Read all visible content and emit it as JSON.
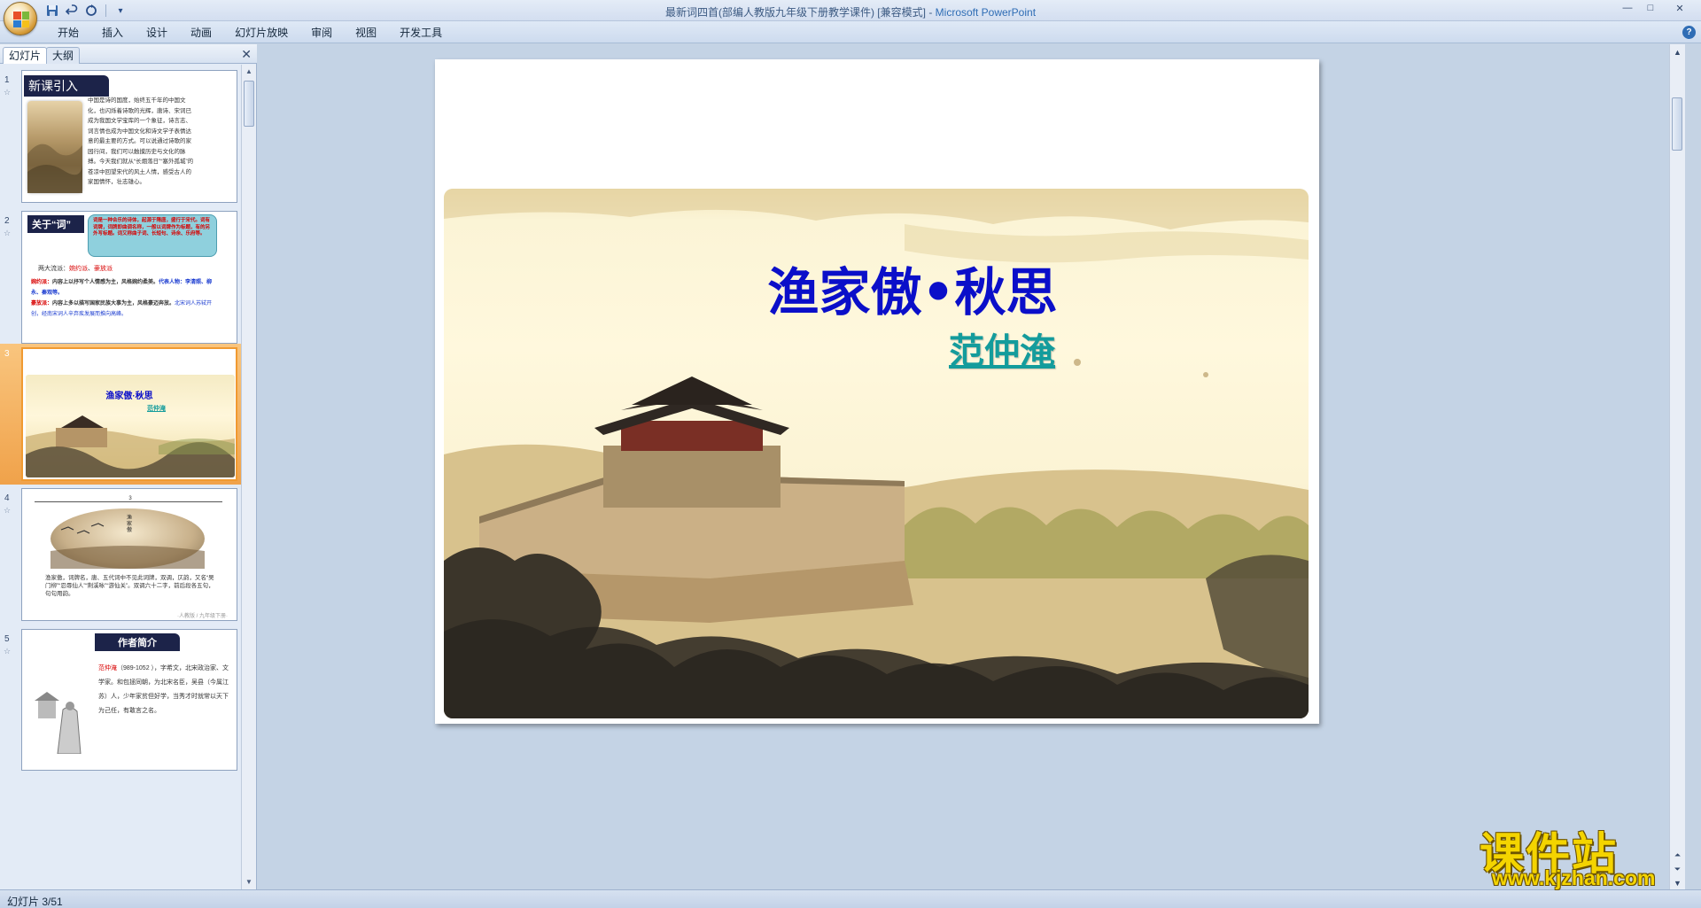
{
  "window": {
    "title": "最新词四首(部编人教版九年级下册教学课件) [兼容模式] - Microsoft PowerPoint",
    "title_doc": "最新词四首(部编人教版九年级下册教学课件) [兼容模式]",
    "title_app": "Microsoft PowerPoint",
    "controls": {
      "minimize": "—",
      "restore": "□",
      "close": "✕"
    }
  },
  "quick_access": {
    "save_icon": "save-icon",
    "undo_icon": "undo-icon",
    "redo_icon": "redo-icon",
    "customize": "▾"
  },
  "ribbon": {
    "tabs": [
      "开始",
      "插入",
      "设计",
      "动画",
      "幻灯片放映",
      "审阅",
      "视图",
      "开发工具"
    ],
    "help": "?"
  },
  "left_panel": {
    "tabs": [
      "幻灯片",
      "大纲"
    ],
    "active_tab": "幻灯片",
    "close": "✕",
    "thumbnails": [
      {
        "number": "1",
        "title": "新课引入",
        "body": "中国是诗的国度，始终五千年的中国文化，也闪烁着诗歌的光辉，唐诗、宋词已成为我国文学宝库的一个象征，诗言志、词言情也成为中国文化和诗文学子表情达意的最主要的方式。可以说通过诗歌的家园行间，我们可以触摸历史与文化的脉搏。今天我们就从“长烟落日”“塞外孤城”的苍凉中回望宋代的风土人情，感受古人的家国情怀，壮志雄心。"
      },
      {
        "number": "2",
        "title": "关于“词”",
        "bubble": "词是一种合乐的诗体，起源于隋唐，盛行于宋代。词有词牌，词牌即曲调名称，一般以词牌作为标题，有的另外写标题。词又称曲子词、长短句、诗余、乐府等。",
        "line1_label": "两大流派：",
        "line1_a": "婉约派",
        "line1_sep": "、",
        "line1_b": "豪放派",
        "line2_label": "婉约派：",
        "line2_text": "内容上以抒写个人情感为主，风格婉约柔美。",
        "line2_reps": "代表人物：李清照、柳永、秦观等。",
        "line3_label": "豪放派：",
        "line3_text": "内容上多以描写国家民族大事为主，风格豪迈奔放。",
        "line3_reps": "北宋词人苏轼开创，经南宋词人辛弃疾发展而推向高峰。"
      },
      {
        "number": "3",
        "title": "渔家傲·秋思",
        "author": "范仲淹"
      },
      {
        "number": "4",
        "ornament": "3",
        "vertical_title": "渔家傲",
        "body": "渔家傲，词牌名，唐、五代词中不见此词牌，双调，仄韵，又名“吴门柳”“忍辱仙人”“荆溪咏”“游仙关”。双调六十二字，前后段各五句，句句用韵。",
        "footer": "·人教版 / 九年级下册·"
      },
      {
        "number": "5",
        "title": "作者简介",
        "name": "范仲淹",
        "years": "（989-1052 ），",
        "body": "字希文，北宋政治家、文学家。和包拯同朝，为北宋名臣，吴县（今属江苏）人，少年家贫但好学，当秀才时就常以天下为己任，有敢言之名。"
      }
    ]
  },
  "slide": {
    "title": "渔家傲•秋思",
    "author": "范仲淹"
  },
  "status": {
    "text": "幻灯片 3/51"
  },
  "watermark": {
    "name": "课件站",
    "url": "www.kjzhan.com"
  },
  "colors": {
    "title_blue": "#0b0fc9",
    "author_teal": "#149c9c",
    "selection_orange": "#f0a24a",
    "thumb_title_navy": "#1c2349",
    "watermark_yellow": "#f4d400"
  }
}
